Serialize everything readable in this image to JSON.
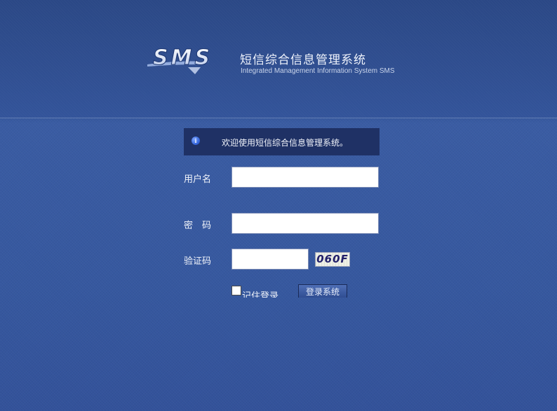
{
  "header": {
    "logo_text": "SMS",
    "title": "短信综合信息管理系统",
    "subtitle": "Integrated Management Information System SMS"
  },
  "notice": {
    "icon": "info-icon",
    "text": "欢迎使用短信综合信息管理系统。"
  },
  "form": {
    "username_label": "用户名",
    "username_value": "",
    "password_label": "密　码",
    "password_value": "",
    "captcha_label": "验证码",
    "captcha_value": "",
    "captcha_image_text": "060F",
    "remember_label": "记住登录",
    "remember_checked": false,
    "login_button_label": "登录系统"
  },
  "colors": {
    "background": "#34549a",
    "header_background": "#2f4d8f",
    "notice_background": "#1f3165",
    "text": "#f2f5fb"
  }
}
